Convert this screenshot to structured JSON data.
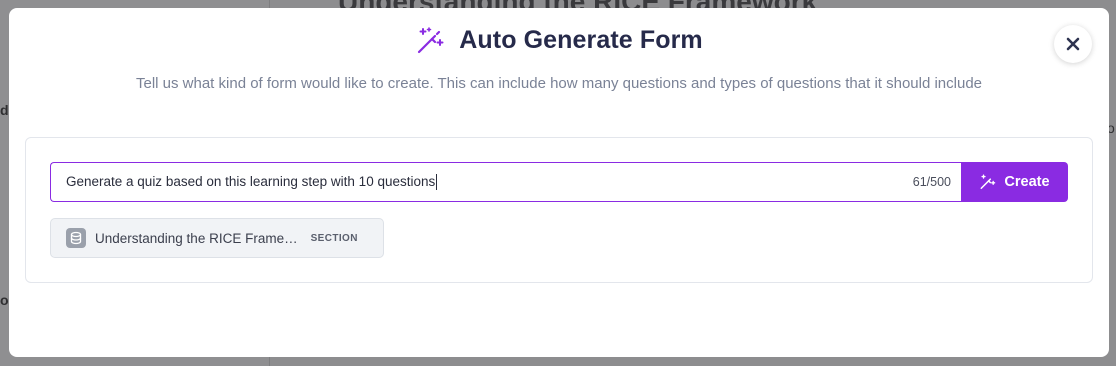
{
  "background": {
    "page_title": "Understanding the RICE Framework",
    "fragments": [
      "d",
      "o",
      "o"
    ]
  },
  "modal": {
    "title": "Auto Generate Form",
    "title_icon": "magic-wand-icon",
    "subtitle": "Tell us what kind of form would like to create. This can include how many questions and types of questions that it should include",
    "close_icon": "close-icon",
    "prompt": {
      "value": "Generate a quiz based on this learning step with 10 questions",
      "counter": "61/500"
    },
    "create_button": {
      "label": "Create",
      "icon": "magic-wand-icon"
    },
    "context_chip": {
      "icon": "layers-icon",
      "label": "Understanding the RICE Frame…",
      "tag": "SECTION"
    }
  },
  "colors": {
    "accent": "#8a2be2",
    "title": "#262a4a",
    "subtitle": "#7a8296",
    "overlay": "#8d8d8f"
  }
}
